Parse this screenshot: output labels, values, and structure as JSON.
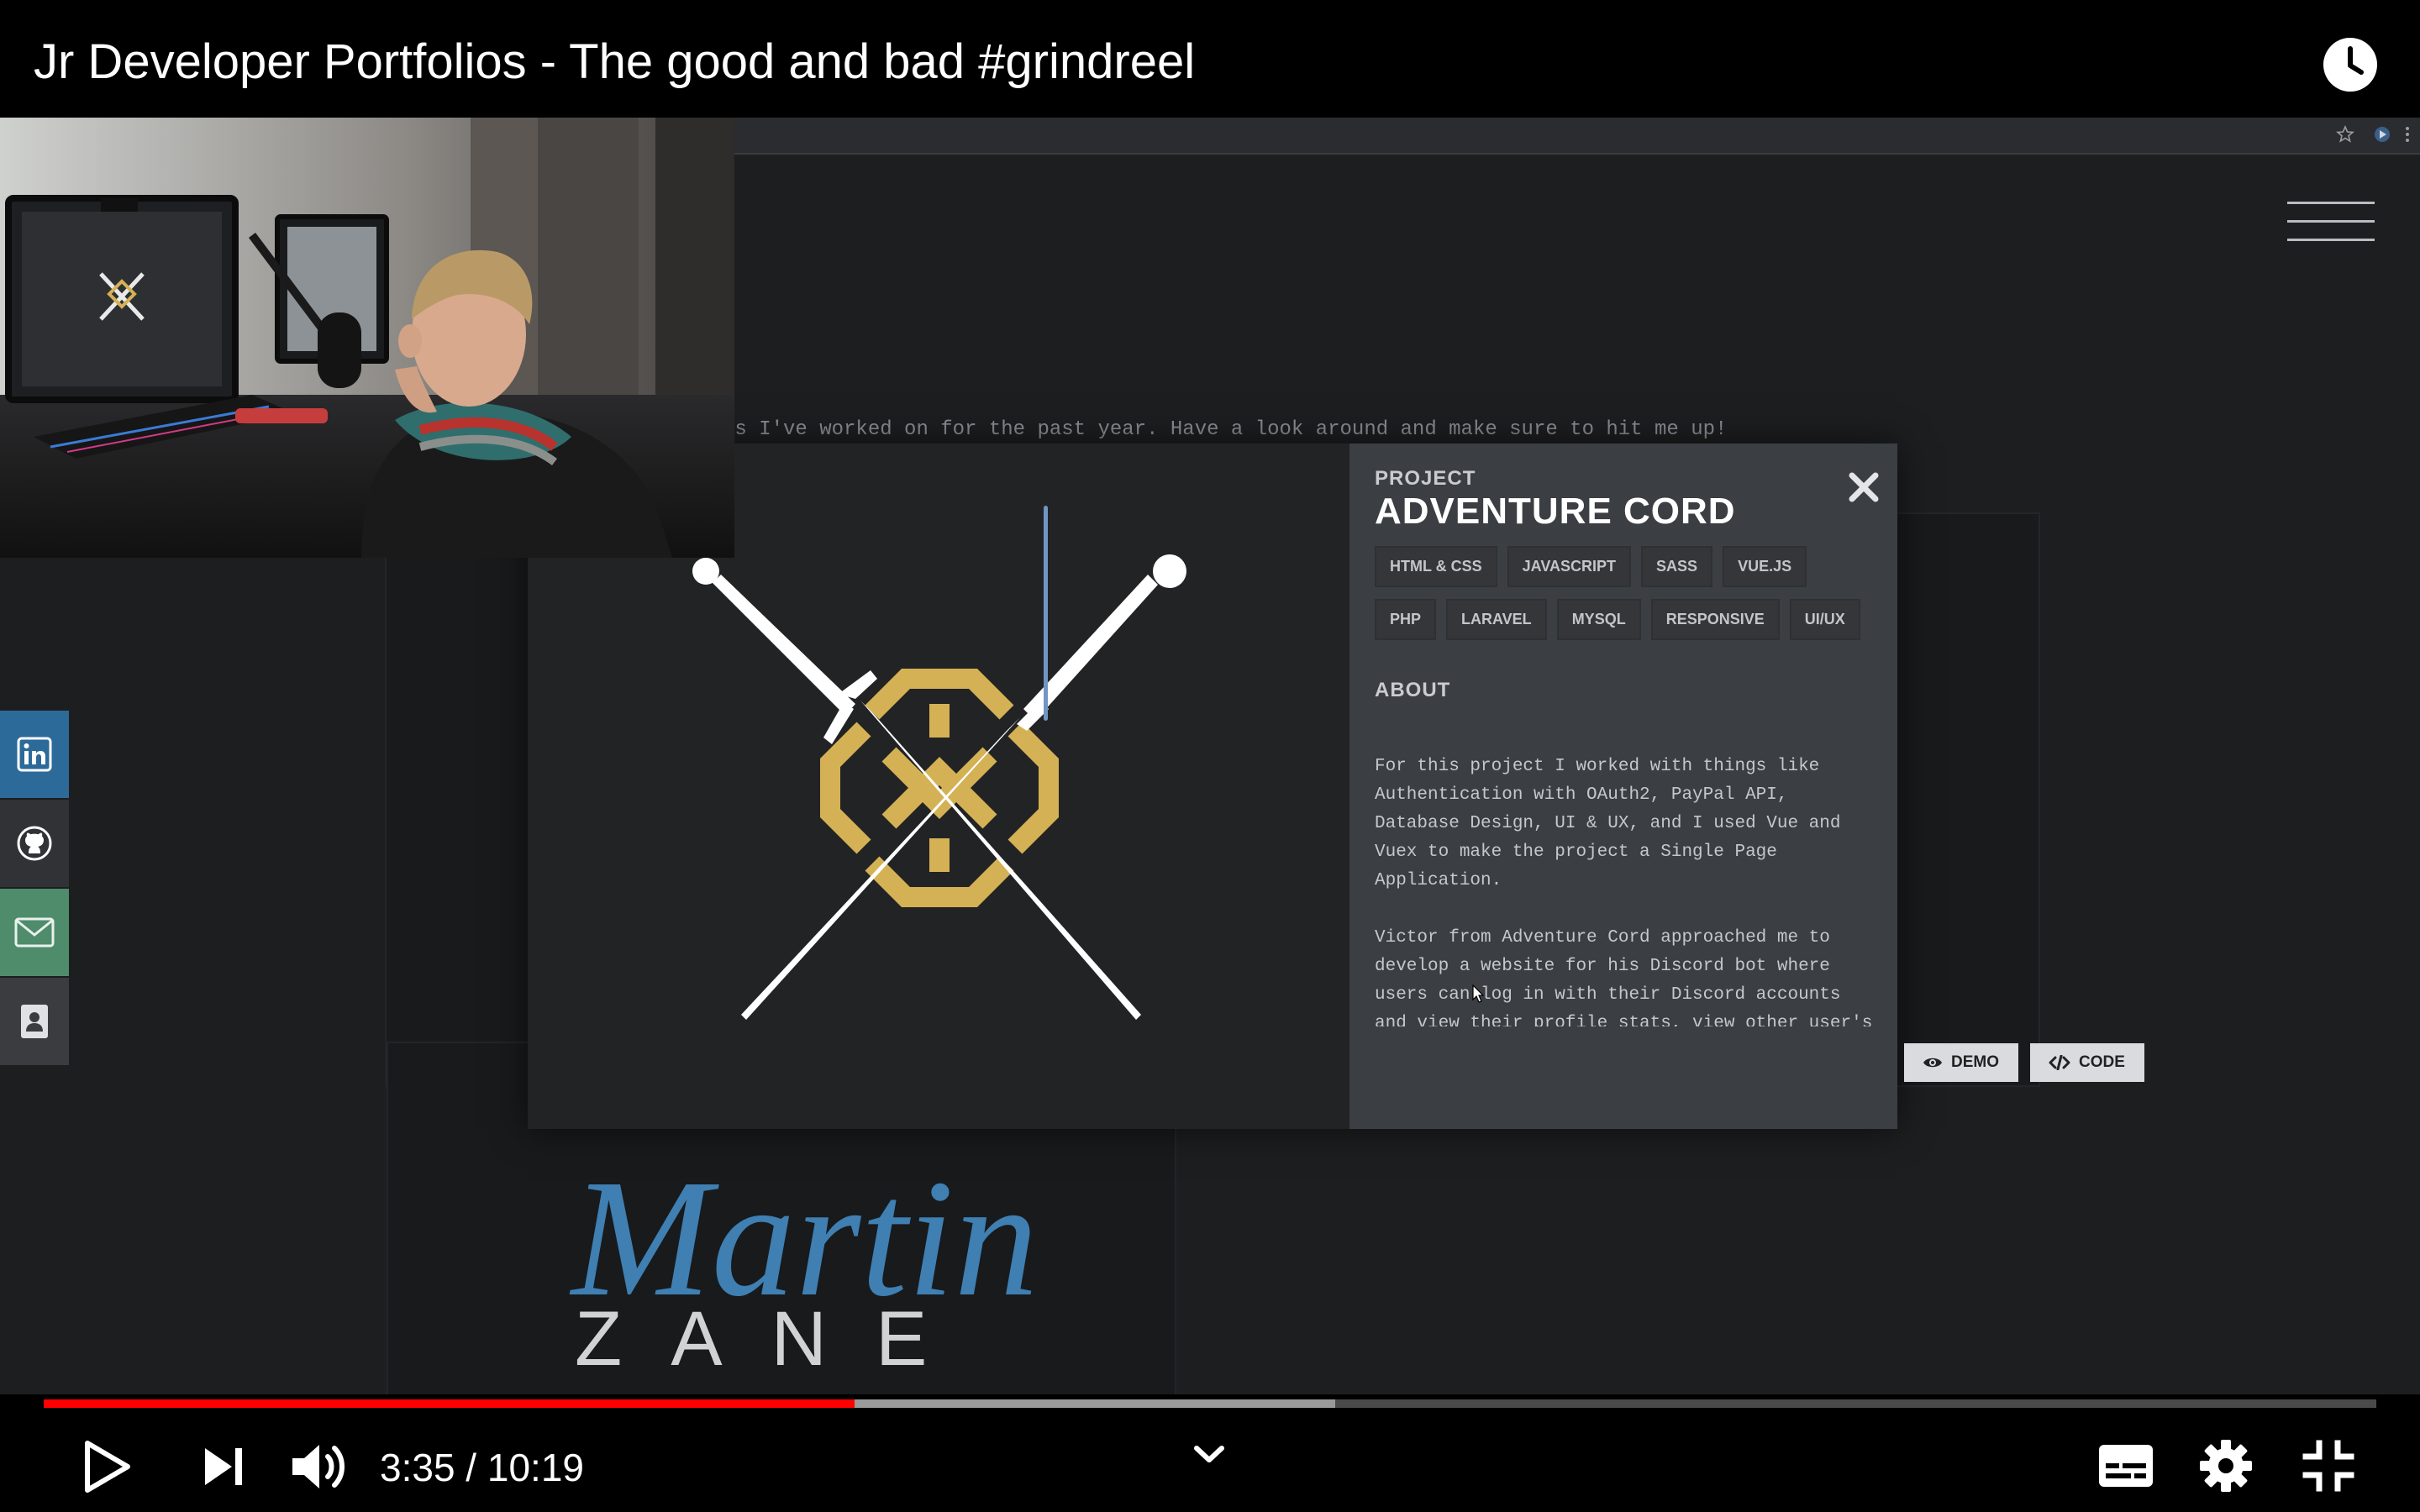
{
  "video": {
    "title": "Jr Developer Portfolios - The good and bad #grindreel"
  },
  "site": {
    "intro_text": "ts I've worked on for the past year. Have a look around and make sure to hit me up!",
    "logo_script": "Martin",
    "logo_caps": "ZANE",
    "social_icons": [
      "linkedin-icon",
      "github-icon",
      "email-icon",
      "contact-card-icon"
    ]
  },
  "modal": {
    "label": "PROJECT",
    "title": "ADVENTURE CORD",
    "tags": [
      "HTML & CSS",
      "JAVASCRIPT",
      "SASS",
      "VUE.JS",
      "PHP",
      "LARAVEL",
      "MYSQL",
      "RESPONSIVE",
      "UI/UX"
    ],
    "about_label": "ABOUT",
    "about_paragraphs": [
      "For this project I worked with things like Authentication with OAuth2, PayPal API, Database Design, UI & UX, and I used Vue and Vuex to make the project a Single Page Application.",
      "Victor from Adventure Cord approached me to develop a website for his Discord bot where users can log in with their Discord accounts and view their profile stats, view other user's stats, read news and updates for the bot directly from the team and"
    ],
    "demo_label": "DEMO",
    "code_label": "CODE"
  },
  "player": {
    "time": "3:35 / 10:19",
    "played_fraction": 0.3475,
    "buffered_fraction": 0.5535,
    "colors": {
      "played": "#ff0000",
      "buffered": "#9a9a9a",
      "track": "#4a4a4a"
    }
  }
}
